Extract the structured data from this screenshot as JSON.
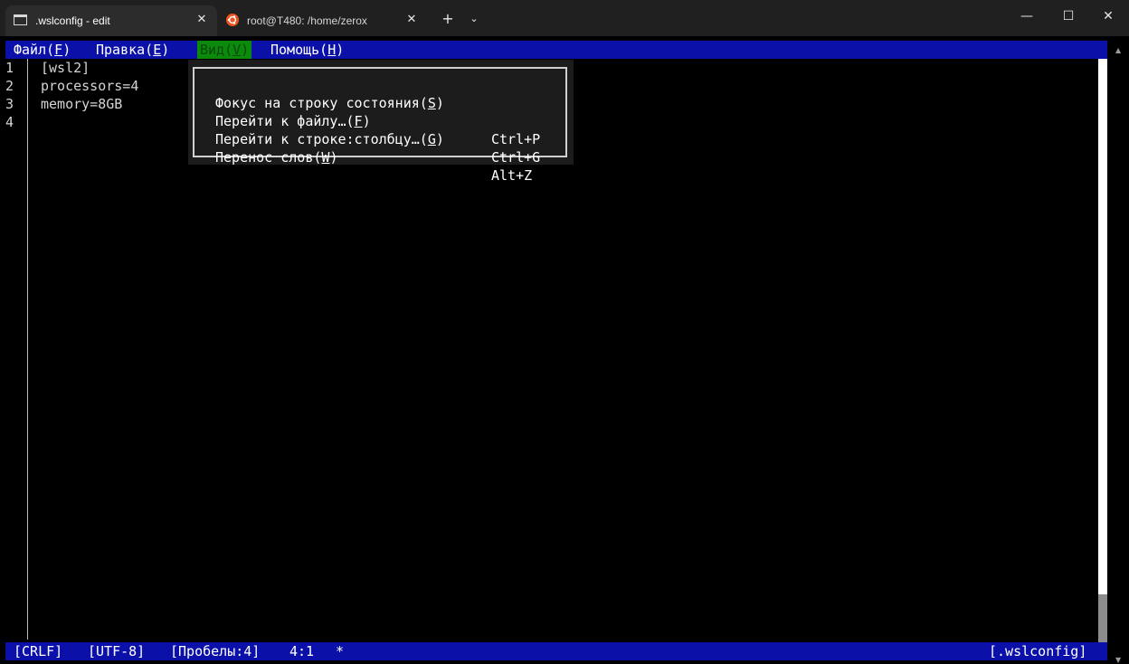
{
  "tabs": [
    {
      "title": ".wslconfig - edit",
      "icon": "terminal-icon",
      "active": true
    },
    {
      "title": "root@T480: /home/zerox",
      "icon": "ubuntu-icon",
      "active": false
    }
  ],
  "window_controls": {
    "minimize": "—",
    "maximize": "☐",
    "close": "✕",
    "new_tab": "+",
    "dropdown": "⌄",
    "tab_close": "✕"
  },
  "menubar": [
    {
      "label": "Файл(",
      "hotkey": "F",
      "suffix": ")"
    },
    {
      "label": "Правка(",
      "hotkey": "E",
      "suffix": ")"
    },
    {
      "label": "Вид(",
      "hotkey": "V",
      "suffix": ")"
    },
    {
      "label": "Помощь(",
      "hotkey": "H",
      "suffix": ")"
    }
  ],
  "editor": {
    "line_numbers": [
      "1",
      "2",
      "3",
      "4"
    ],
    "lines": [
      "[wsl2]",
      "processors=4",
      "memory=8GB",
      ""
    ]
  },
  "view_menu": [
    {
      "label": "Фокус на строку состояния(",
      "hotkey": "S",
      "suffix": ")",
      "shortcut": ""
    },
    {
      "label": "Перейти к файлу…(",
      "hotkey": "F",
      "suffix": ")",
      "shortcut": "Ctrl+P"
    },
    {
      "label": "Перейти к строке:столбцу…(",
      "hotkey": "G",
      "suffix": ")",
      "shortcut": "Ctrl+G"
    },
    {
      "label": "Перенос слов(",
      "hotkey": "W",
      "suffix": ")",
      "shortcut": "Alt+Z"
    }
  ],
  "statusbar": {
    "line_ending": "[CRLF]",
    "encoding": "[UTF-8]",
    "indent": "[Пробелы:4]",
    "cursor": "4:1",
    "modified": "*",
    "filename": "[.wslconfig]"
  },
  "colors": {
    "menubar_bg": "#0b10a8",
    "menu_open_bg": "#0b8a0b",
    "tab_bg": "#202020",
    "active_tab_bg": "#2c2c2c",
    "ubuntu_orange": "#e95420"
  }
}
